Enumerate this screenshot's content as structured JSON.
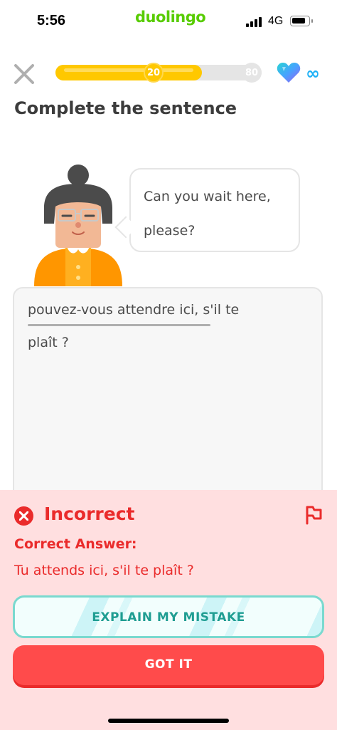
{
  "status_bar": {
    "time": "5:56",
    "app_name": "duolingo",
    "network": "4G"
  },
  "header": {
    "progress": {
      "current_label": "20",
      "max_label": "80",
      "fill_fraction": 0.71
    },
    "hearts": {
      "icon": "gem-heart-icon",
      "value": "∞"
    }
  },
  "prompt": {
    "title": "Complete the sentence"
  },
  "bubble": {
    "line1": "Can you wait here,",
    "line2": "please?"
  },
  "answer": {
    "line1": "pouvez-vous attendre ici, s'il te",
    "line2": "plaît ?"
  },
  "feedback": {
    "status": "Incorrect",
    "correct_label": "Correct Answer:",
    "correct_answer": "Tu attends ici, s'il te plaît ?",
    "explain_button": "EXPLAIN MY MISTAKE",
    "continue_button": "GOT IT"
  },
  "colors": {
    "brand": "#58cc02",
    "error": "#ea2b2b",
    "progress": "#ffc800",
    "feedback_bg": "#ffdfe0",
    "explain": "#1f9d92"
  }
}
